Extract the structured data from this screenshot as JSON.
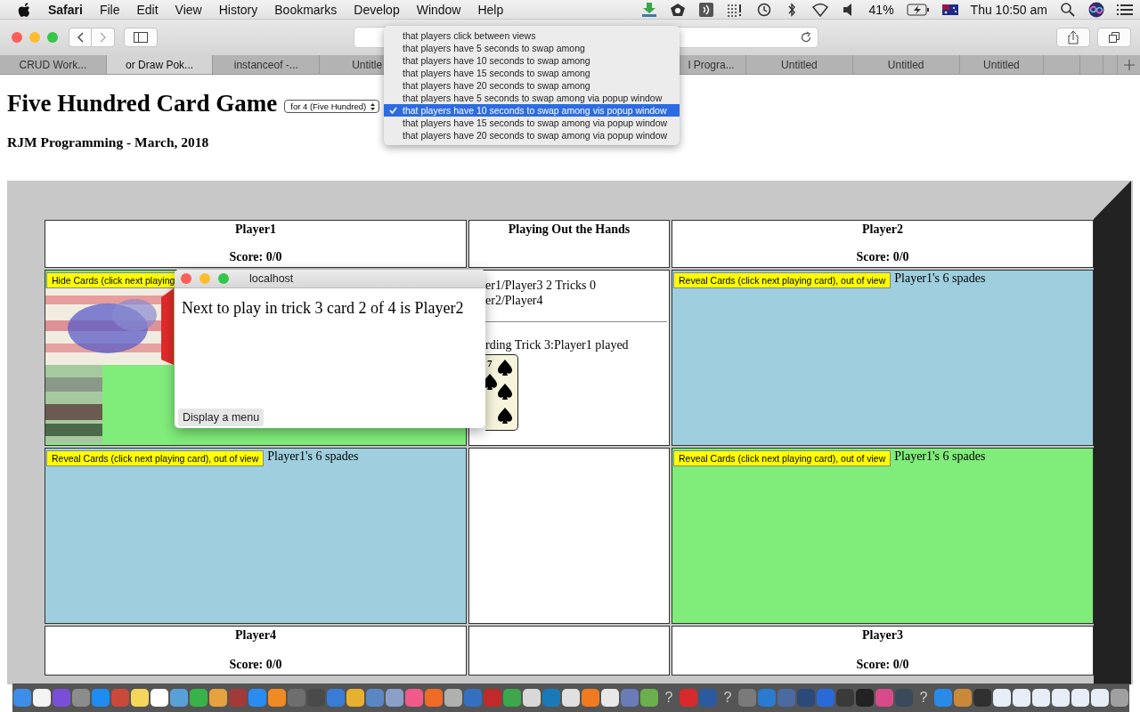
{
  "menu_bar": {
    "app": "Safari",
    "items": [
      "File",
      "Edit",
      "View",
      "History",
      "Bookmarks",
      "Develop",
      "Window",
      "Help"
    ],
    "battery": "41%",
    "clock": "Thu 10:50 am"
  },
  "tabs": [
    {
      "label": "CRUD Work...",
      "selected": false
    },
    {
      "label": "or Draw Pok...",
      "selected": true
    },
    {
      "label": "instanceof -...",
      "selected": false
    },
    {
      "label": "Untitle",
      "selected": false
    },
    {
      "label": "l Progra...",
      "selected": false
    },
    {
      "label": "Untitled",
      "selected": false
    },
    {
      "label": "Untitled",
      "selected": false
    },
    {
      "label": "Untitled",
      "selected": false
    }
  ],
  "page": {
    "title": "Five Hundred Card Game",
    "players_select": "for 4 (Five Hundred)",
    "subtitle": "RJM Programming - March, 2018"
  },
  "swap_menu": {
    "options": [
      {
        "label": "that players click between views",
        "selected": false
      },
      {
        "label": "that players have 5 seconds to swap among",
        "selected": false
      },
      {
        "label": "that players have 10 seconds to swap among",
        "selected": false
      },
      {
        "label": "that players have 15 seconds to swap among",
        "selected": false
      },
      {
        "label": "that players have 20 seconds to swap among",
        "selected": false
      },
      {
        "label": "that players have 5 seconds to swap among via popup window",
        "selected": false
      },
      {
        "label": "that players have 10 seconds to swap among vis popup window",
        "selected": true
      },
      {
        "label": "that players have 15 seconds to swap among via popup window",
        "selected": false
      },
      {
        "label": "that players have 20 seconds to swap among via popup window",
        "selected": false
      }
    ]
  },
  "board": {
    "header": [
      {
        "kind": "player",
        "name": "Player1",
        "score": "Score: 0/0"
      },
      {
        "kind": "status",
        "title": "Playing Out the Hands"
      },
      {
        "kind": "player",
        "name": "Player2",
        "score": "Score: 0/0"
      }
    ],
    "rows": [
      [
        {
          "kind": "hidden-hand",
          "color": "#80ec7a",
          "button": "Hide Cards (click next playing"
        },
        {
          "kind": "tricks",
          "lines": [
            "er1/Player3 2 Tricks 0",
            "er2/Player4"
          ],
          "note": "rding Trick 3:Player1 played",
          "card_rank": "7"
        },
        {
          "kind": "hand",
          "color": "#9fcfde",
          "button": "Reveal Cards (click next playing card), out of view",
          "label": "Player1's 6 spades"
        }
      ],
      [
        {
          "kind": "hand",
          "color": "#9fcfde",
          "button": "Reveal Cards (click next playing card), out of view",
          "label": "Player1's 6 spades"
        },
        {
          "kind": "empty"
        },
        {
          "kind": "hand",
          "color": "#80ec7a",
          "button": "Reveal Cards (click next playing card), out of view",
          "label": "Player1's 6 spades"
        }
      ]
    ],
    "footer": [
      {
        "kind": "player",
        "name": "Player4",
        "score": "Score: 0/0"
      },
      {
        "kind": "empty"
      },
      {
        "kind": "player",
        "name": "Player3",
        "score": "Score: 0/0"
      }
    ]
  },
  "popup": {
    "title": "localhost",
    "message": "Next to play in trick 3 card 2 of 4 is Player2",
    "button": "Display a menu"
  },
  "dock": {
    "items": [
      {
        "kind": "app",
        "color": "#3d8ee8"
      },
      {
        "kind": "app",
        "color": "#f4f4f4"
      },
      {
        "kind": "app",
        "color": "#7a4fd8"
      },
      {
        "kind": "app",
        "color": "#8c8c8c"
      },
      {
        "kind": "app",
        "color": "#1e8cf0"
      },
      {
        "kind": "app",
        "color": "#c94a3a"
      },
      {
        "kind": "app",
        "color": "#f3d65a"
      },
      {
        "kind": "app",
        "color": "#ffffff"
      },
      {
        "kind": "app",
        "color": "#5aa0d8"
      },
      {
        "kind": "app",
        "color": "#38b34a"
      },
      {
        "kind": "app",
        "color": "#e6a23c"
      },
      {
        "kind": "app",
        "color": "#a33a3a"
      },
      {
        "kind": "app",
        "color": "#2a8cf0"
      },
      {
        "kind": "app",
        "color": "#f08a24"
      },
      {
        "kind": "app",
        "color": "#6e6e6e"
      },
      {
        "kind": "app",
        "color": "#4a4a4a"
      },
      {
        "kind": "app",
        "color": "#3a7bd5"
      },
      {
        "kind": "app",
        "color": "#e8b030"
      },
      {
        "kind": "app",
        "color": "#5b86c4"
      },
      {
        "kind": "app",
        "color": "#8aa0c8"
      },
      {
        "kind": "app",
        "color": "#f05a8a"
      },
      {
        "kind": "app",
        "color": "#f06a28"
      },
      {
        "kind": "app",
        "color": "#b0b0b0"
      },
      {
        "kind": "app",
        "color": "#3570c0"
      },
      {
        "kind": "app",
        "color": "#c02a2a"
      },
      {
        "kind": "app",
        "color": "#3ca84a"
      },
      {
        "kind": "app",
        "color": "#d8d8d8"
      },
      {
        "kind": "app",
        "color": "#1a7ab8"
      },
      {
        "kind": "app",
        "color": "#e0e0e0"
      },
      {
        "kind": "app",
        "color": "#f07a20"
      },
      {
        "kind": "app",
        "color": "#e8e8e8"
      },
      {
        "kind": "app",
        "color": "#6a7bb8"
      },
      {
        "kind": "app",
        "color": "#6ab04c"
      },
      {
        "kind": "unknown",
        "label": "?"
      },
      {
        "kind": "app",
        "color": "#d82a2a"
      },
      {
        "kind": "app",
        "color": "#2c5aa0"
      },
      {
        "kind": "unknown",
        "label": "?"
      },
      {
        "kind": "app",
        "color": "#7a7a7a"
      },
      {
        "kind": "app",
        "color": "#2a7ad0"
      },
      {
        "kind": "app",
        "color": "#4a6aa0"
      },
      {
        "kind": "app",
        "color": "#2a4a7a"
      },
      {
        "kind": "app",
        "color": "#2a6ad8"
      },
      {
        "kind": "app",
        "color": "#3a3a3a"
      },
      {
        "kind": "app",
        "color": "#222222"
      },
      {
        "kind": "app",
        "color": "#d84a8a"
      },
      {
        "kind": "app",
        "color": "#3a4a5a"
      },
      {
        "kind": "unknown",
        "label": "?"
      },
      {
        "kind": "app",
        "color": "#2a8ae8"
      },
      {
        "kind": "app",
        "color": "#c88a3a"
      },
      {
        "kind": "app",
        "color": "#303030"
      },
      {
        "kind": "app",
        "color": "#e8eef8"
      },
      {
        "kind": "app",
        "color": "#e8eef8"
      },
      {
        "kind": "app",
        "color": "#e8eef8"
      },
      {
        "kind": "app",
        "color": "#e8eef8"
      },
      {
        "kind": "app",
        "color": "#e8eef8"
      },
      {
        "kind": "app",
        "color": "#e8eef8"
      },
      {
        "kind": "app",
        "color": "#a0a0a0"
      }
    ]
  }
}
